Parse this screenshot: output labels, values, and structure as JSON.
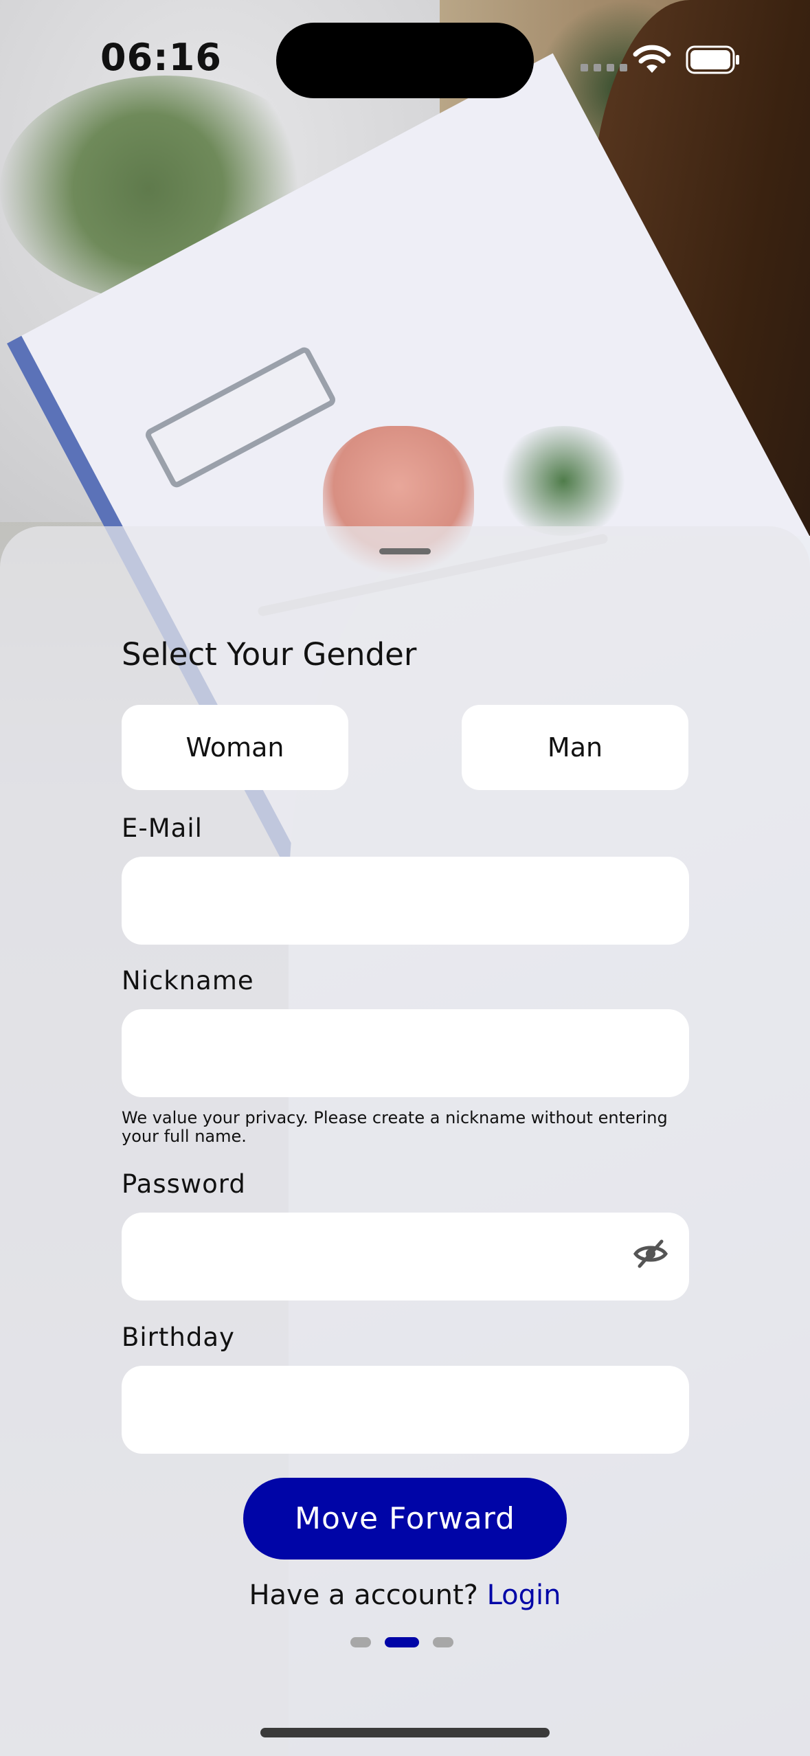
{
  "status_bar": {
    "time": "06:16"
  },
  "form": {
    "title": "Select Your Gender",
    "gender_options": [
      "Woman",
      "Man"
    ],
    "email_label": "E-Mail",
    "email_value": "",
    "nickname_label": "Nickname",
    "nickname_value": "",
    "nickname_hint": "We value your privacy. Please create a nickname without entering your full name.",
    "password_label": "Password",
    "password_value": "",
    "birthday_label": "Birthday",
    "birthday_value": "",
    "submit_label": "Move Forward",
    "account_prompt": "Have a account?",
    "login_link": "Login"
  },
  "pager": {
    "count": 3,
    "active_index": 1
  },
  "colors": {
    "accent": "#0005A7",
    "sheet": "#E8E8EC"
  },
  "icons": [
    "wifi-icon",
    "battery-icon",
    "eye-slash-icon"
  ]
}
